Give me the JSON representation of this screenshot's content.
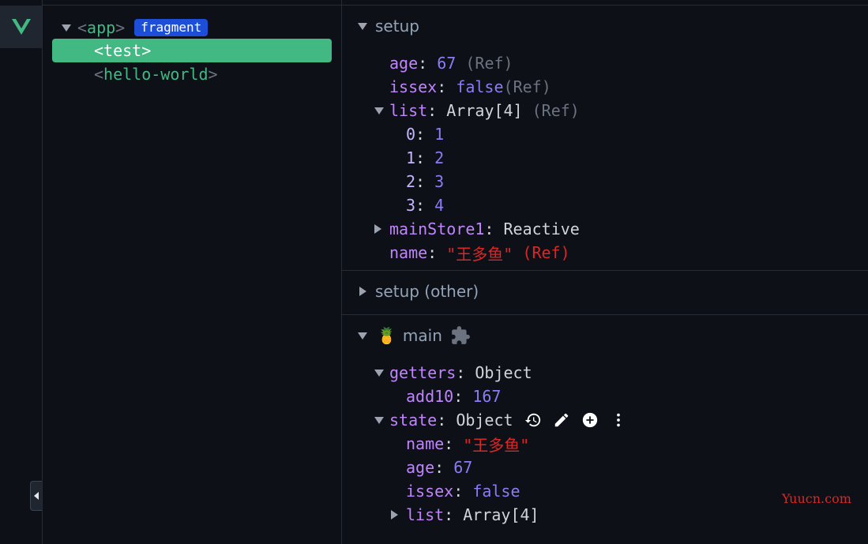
{
  "tree": {
    "nodes": [
      {
        "open": "<",
        "name": "app",
        "close": ">",
        "badge": "fragment"
      },
      {
        "open": "<",
        "name": "test",
        "close": ">"
      },
      {
        "open": "<",
        "name": "hello-world",
        "close": ">"
      }
    ]
  },
  "setup": {
    "title": "setup",
    "age": {
      "key": "age",
      "value": "67",
      "ref": "(Ref)"
    },
    "issex": {
      "key": "issex",
      "value": "false",
      "ref": "(Ref)"
    },
    "list": {
      "key": "list",
      "value": "Array[4]",
      "ref": "(Ref)",
      "items": [
        {
          "k": "0",
          "v": "1"
        },
        {
          "k": "1",
          "v": "2"
        },
        {
          "k": "2",
          "v": "3"
        },
        {
          "k": "3",
          "v": "4"
        }
      ]
    },
    "mainStore1": {
      "key": "mainStore1",
      "value": "Reactive"
    },
    "name": {
      "key": "name",
      "value": "\"王多鱼\"",
      "ref": "(Ref)"
    }
  },
  "setup_other": {
    "title": "setup (other)"
  },
  "main": {
    "emoji": "🍍",
    "title": "main",
    "getters": {
      "key": "getters",
      "value": "Object",
      "add10_key": "add10",
      "add10_value": "167"
    },
    "state": {
      "key": "state",
      "value": "Object",
      "name_key": "name",
      "name_value": "\"王多鱼\"",
      "age_key": "age",
      "age_value": "67",
      "issex_key": "issex",
      "issex_value": "false",
      "list_key": "list",
      "list_value": "Array[4]"
    }
  },
  "watermark": "Yuucn.com",
  "colors": {
    "accent": "#42b883",
    "badge": "#1d4ed8",
    "background": "#0d1117"
  }
}
